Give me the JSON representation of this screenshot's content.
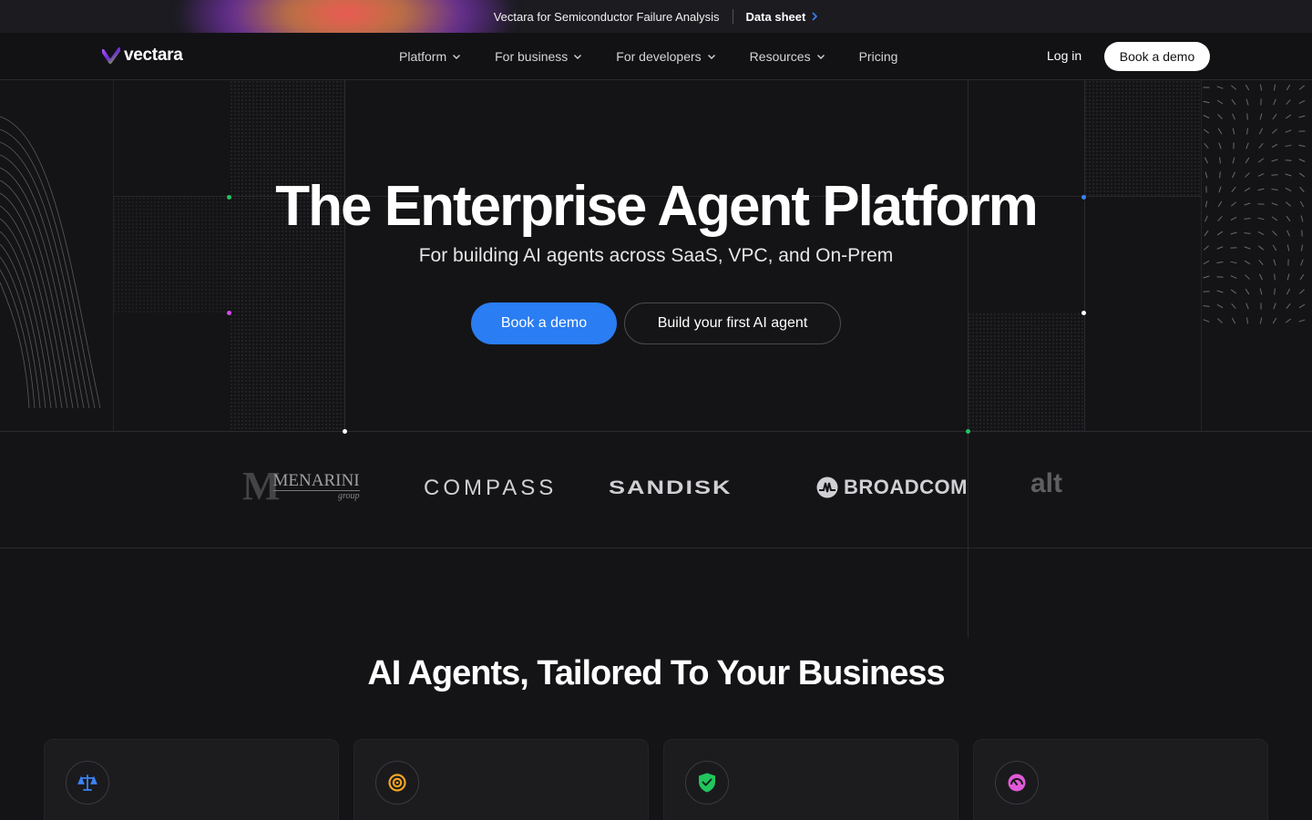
{
  "announcement": {
    "text": "Vectara for Semiconductor Failure Analysis",
    "link_label": "Data sheet"
  },
  "nav": {
    "brand": "vectara",
    "menu": [
      {
        "label": "Platform",
        "has_dropdown": true
      },
      {
        "label": "For business",
        "has_dropdown": true
      },
      {
        "label": "For developers",
        "has_dropdown": true
      },
      {
        "label": "Resources",
        "has_dropdown": true
      },
      {
        "label": "Pricing",
        "has_dropdown": false
      }
    ],
    "login_label": "Log in",
    "cta_label": "Book a demo"
  },
  "hero": {
    "title": "The Enterprise Agent Platform",
    "subtitle": "For building AI agents across SaaS, VPC, and On-Prem",
    "primary_cta": "Book a demo",
    "secondary_cta": "Build your first AI agent"
  },
  "clients": {
    "menarini": {
      "name": "MENARINI",
      "tagline": "group"
    },
    "compass": "COMPASS",
    "sandisk": "SANDISK",
    "broadcom": "BROADCOM",
    "partial": "alt"
  },
  "section": {
    "title": "AI Agents, Tailored To Your Business"
  },
  "cards": [
    {
      "icon": "scales-icon",
      "color": "#3b82f6"
    },
    {
      "icon": "target-icon",
      "color": "#f5a524"
    },
    {
      "icon": "shield-check-icon",
      "color": "#22c55e"
    },
    {
      "icon": "gauge-icon",
      "color": "#e05ad6"
    }
  ],
  "colors": {
    "accent_blue": "#2a7df2",
    "background": "#141416",
    "dot_green": "#22c55e",
    "dot_pink": "#d946ef",
    "dot_blue": "#3b82f6"
  }
}
